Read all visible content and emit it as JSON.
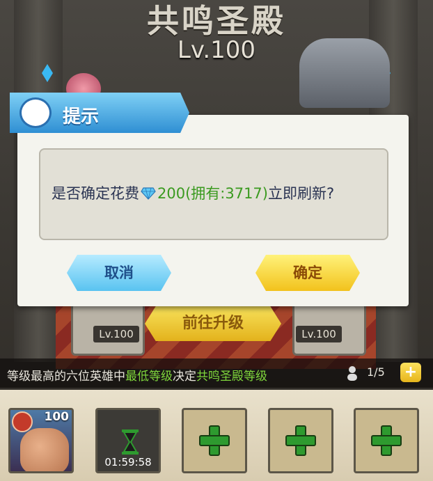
{
  "scene": {
    "title": "共鸣圣殿",
    "level": "Lv.100",
    "platform_levels": [
      "Lv.100",
      "Lv.100"
    ],
    "goto_button": "前往升级"
  },
  "info_bar": {
    "text_prefix": "等级最高的六位英雄中",
    "text_hl1": "最低等级",
    "text_mid": "决定",
    "text_hl2": "共鸣圣殿等级",
    "slots_count": "1/5",
    "plus_label": "+"
  },
  "slots": {
    "hero_level": "100",
    "timer": "01:59:58"
  },
  "dialog": {
    "title": "提示",
    "message_prefix": "是否确定花费",
    "message_cost": "200(拥有:3717)",
    "message_suffix": "立即刷新?",
    "cancel_label": "取消",
    "confirm_label": "确定"
  },
  "icons": {
    "currency": "diamond-icon",
    "banner": "scroll-icon",
    "add": "plus-icon",
    "timer": "hourglass-icon"
  },
  "colors": {
    "highlight_green": "#7fd63c",
    "cost_green": "#3a9a1f",
    "cancel_blue": "#59c3f0",
    "confirm_yellow": "#f2c21c"
  }
}
